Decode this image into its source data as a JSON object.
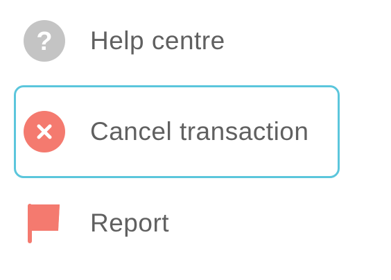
{
  "menu": {
    "items": [
      {
        "label": "Help centre",
        "icon": "help-icon",
        "icon_color": "#c4c4c4",
        "focused": false
      },
      {
        "label": "Cancel transaction",
        "icon": "cancel-icon",
        "icon_color": "#f47a6f",
        "focused": true
      },
      {
        "label": "Report",
        "icon": "flag-icon",
        "icon_color": "#f47a6f",
        "focused": false
      }
    ],
    "focus_border_color": "#5bc6dc",
    "label_color": "#606060"
  }
}
